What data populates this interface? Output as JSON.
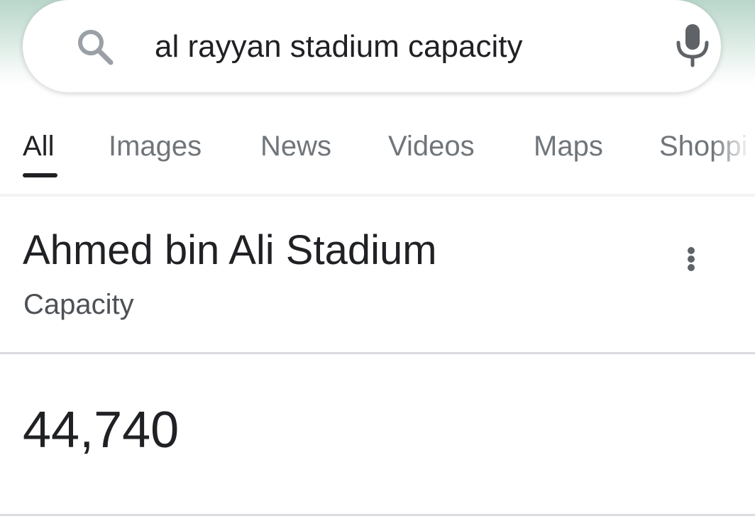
{
  "search": {
    "query": "al rayyan stadium capacity"
  },
  "tabs": [
    {
      "label": "All",
      "active": true
    },
    {
      "label": "Images",
      "active": false
    },
    {
      "label": "News",
      "active": false
    },
    {
      "label": "Videos",
      "active": false
    },
    {
      "label": "Maps",
      "active": false
    },
    {
      "label": "Shoppi",
      "active": false
    }
  ],
  "result": {
    "title": "Ahmed bin Ali Stadium",
    "subtitle": "Capacity",
    "value": "44,740"
  },
  "icons": {
    "search": "search-icon",
    "mic": "mic-icon",
    "more": "more-vert-icon"
  },
  "colors": {
    "header_gradient_top": "#b9d6ca",
    "text_primary": "#202124",
    "text_secondary": "#70757a",
    "icon_gray": "#5f6368"
  }
}
